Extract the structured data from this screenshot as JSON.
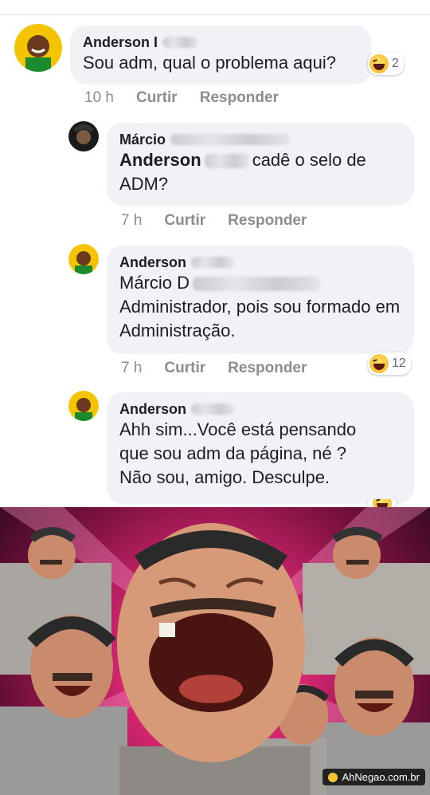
{
  "comments": [
    {
      "author": "Anderson I",
      "text": "Sou adm, qual o problema aqui?",
      "time": "10 h",
      "like": "Curtir",
      "reply": "Responder",
      "reaction_count": "2"
    },
    {
      "author": "Márcio",
      "mention": "Anderson",
      "text": "cadê o selo de ADM?",
      "time": "7 h",
      "like": "Curtir",
      "reply": "Responder"
    },
    {
      "author": "Anderson",
      "mention": "Márcio D",
      "text": "Administrador, pois sou formado em Administração.",
      "time": "7 h",
      "like": "Curtir",
      "reply": "Responder",
      "reaction_count": "12"
    },
    {
      "author": "Anderson",
      "text_lines": [
        "Ahh sim...Você está pensando",
        "que sou adm da página, né ?",
        "Não sou, amigo. Desculpe."
      ]
    }
  ],
  "meme": {
    "watermark": "AhNegao.com.br"
  },
  "colors": {
    "bubble": "#f0f2f5",
    "meta": "#8a8d91",
    "haha": "#f7b125"
  }
}
